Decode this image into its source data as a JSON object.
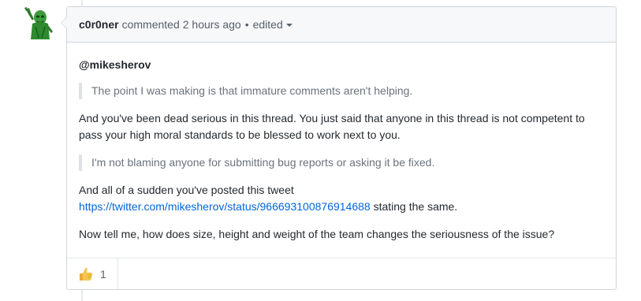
{
  "comment": {
    "author": "c0r0ner",
    "verb": "commented",
    "timestamp": "2 hours ago",
    "separator": "•",
    "edited_label": "edited",
    "avatar_icon": "green-alien-avatar-icon",
    "body": {
      "mention": "@mikesherov",
      "quote_1": "The point I was making is that immature comments aren't helping.",
      "para_1_line_1": "And you've been dead serious in this thread. You just said that anyone in this thread is not competent to",
      "para_1_line_2": "pass your high moral standards to be blessed to work next to you.",
      "quote_2": "I'm not blaming anyone for submitting bug reports or asking it be fixed.",
      "para_2_line_1": "And all of a sudden you've posted this tweet",
      "para_2_link": "https://twitter.com/mikesherov/status/966693100876914688",
      "para_2_rest": " stating the same.",
      "para_3": "Now tell me, how does size, height and weight of the team changes the seriousness of the issue?"
    },
    "reactions": [
      {
        "icon": "thumbs-up-icon",
        "count": "1"
      }
    ]
  },
  "colors": {
    "header_bg": "#f6f8fa",
    "border": "#d1d5da",
    "link": "#0366d6",
    "quote_text": "#6a737d",
    "avatar_green": "#3c9a3c",
    "thumb_yellow": "#f5c451"
  }
}
